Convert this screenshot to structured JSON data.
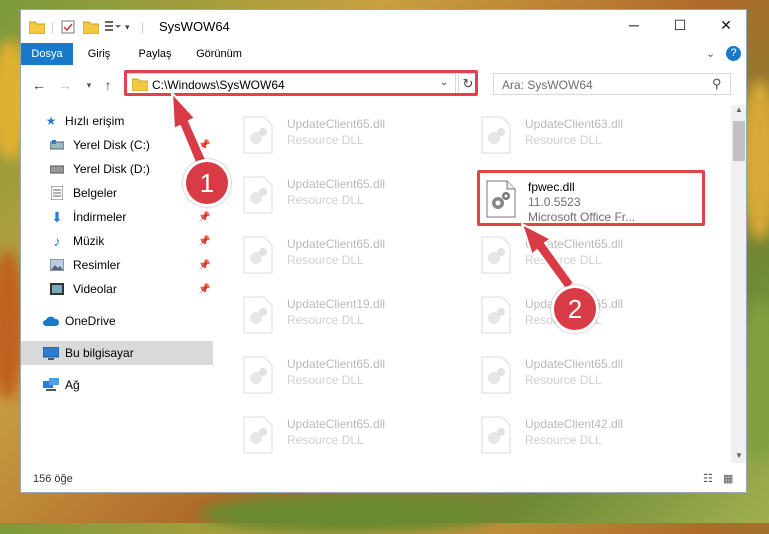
{
  "window": {
    "title": "SysWOW64"
  },
  "ribbon": {
    "tabs": [
      {
        "label": "Dosya"
      },
      {
        "label": "Giriş"
      },
      {
        "label": "Paylaş"
      },
      {
        "label": "Görünüm"
      }
    ]
  },
  "address": {
    "path": "C:\\Windows\\SysWOW64"
  },
  "search": {
    "placeholder": "Ara: SysWOW64"
  },
  "sidebar": {
    "items": [
      {
        "label": "Hızlı erişim"
      },
      {
        "label": "Yerel Disk (C:)"
      },
      {
        "label": "Yerel Disk (D:)"
      },
      {
        "label": "Belgeler"
      },
      {
        "label": "İndirmeler"
      },
      {
        "label": "Müzik"
      },
      {
        "label": "Resimler"
      },
      {
        "label": "Videolar"
      },
      {
        "label": "OneDrive"
      },
      {
        "label": "Bu bilgisayar"
      },
      {
        "label": "Ağ"
      }
    ]
  },
  "files": [
    {
      "name": "UpdateClient65.dll",
      "desc": "Resource DLL"
    },
    {
      "name": "UpdateClient63.dll",
      "desc": "Resource DLL"
    },
    {
      "name": "UpdateClient65.dll",
      "desc": "Resource DLL"
    },
    {
      "name": "UpdateClient65.dll",
      "desc": "Resource DLL"
    },
    {
      "name": "UpdateClient65.dll",
      "desc": "Resource DLL"
    },
    {
      "name": "UpdateClient19.dll",
      "desc": "Resource DLL"
    },
    {
      "name": "UpdateClient65.dll",
      "desc": "Resource DLL"
    },
    {
      "name": "UpdateClient65.dll",
      "desc": "Resource DLL"
    },
    {
      "name": "UpdateClient65.dll",
      "desc": "Resource DLL"
    },
    {
      "name": "UpdateClient65.dll",
      "desc": "Resource DLL"
    },
    {
      "name": "UpdateClient42.dll",
      "desc": "Resource DLL"
    }
  ],
  "highlighted_file": {
    "name": "fpwec.dll",
    "version": "11.0.5523",
    "company": "Microsoft Office Fr..."
  },
  "status": {
    "count": "156 öğe"
  },
  "badges": {
    "one": "1",
    "two": "2"
  },
  "colors": {
    "accent": "#1979ca",
    "highlight": "#e0434a",
    "badge": "#d93b46"
  }
}
